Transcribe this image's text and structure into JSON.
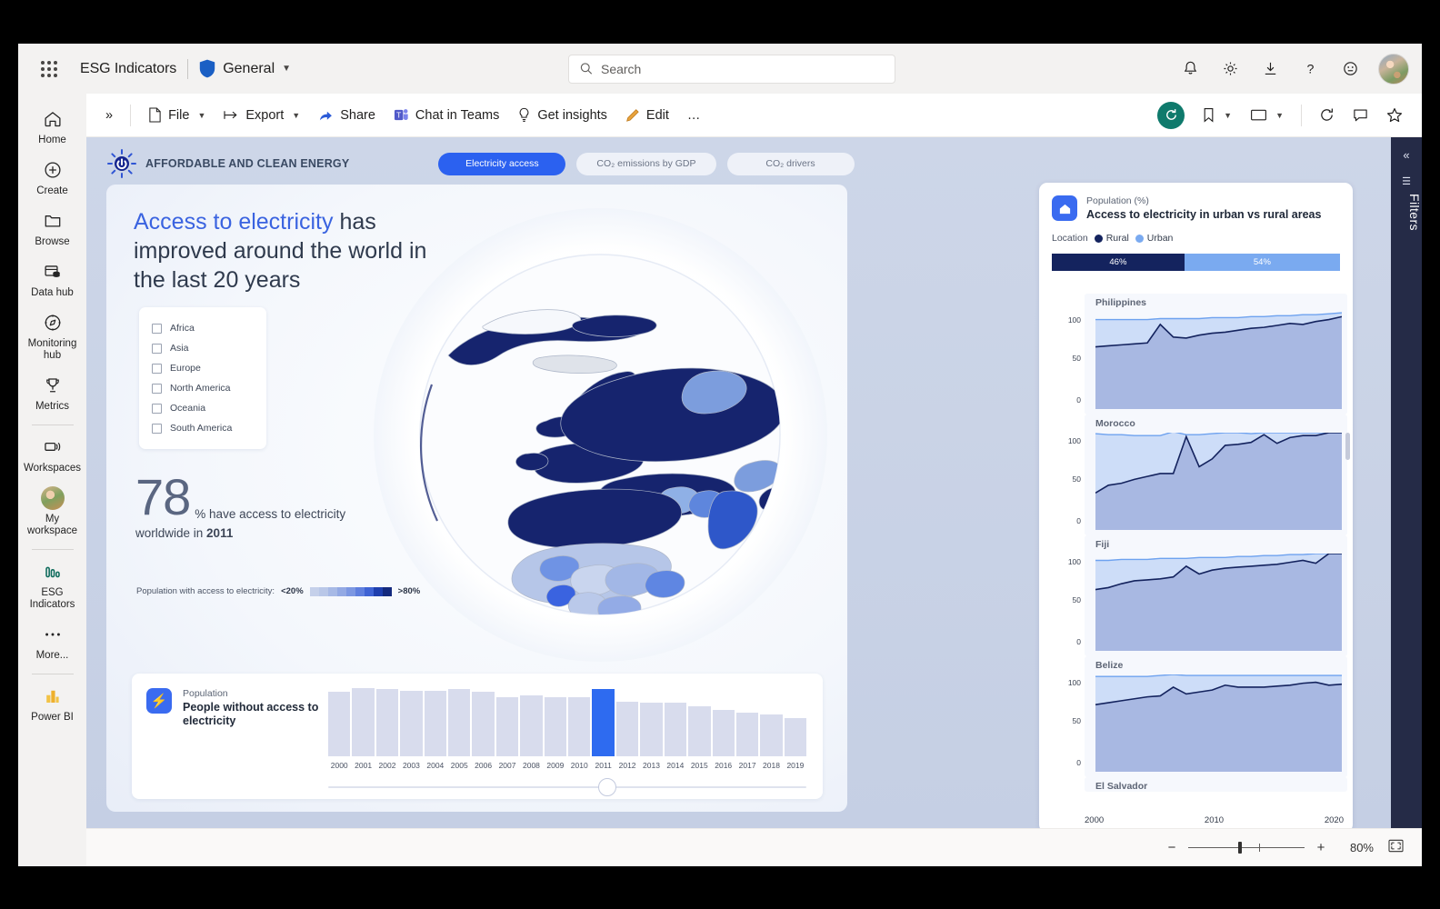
{
  "header": {
    "brand": "ESG Indicators",
    "workspace": "General",
    "search_placeholder": "Search",
    "icons": [
      "notifications-bell-icon",
      "settings-gear-icon",
      "download-icon",
      "help-icon",
      "feedback-smiley-icon"
    ]
  },
  "nav": {
    "items": [
      {
        "label": "Home",
        "icon": "home-icon"
      },
      {
        "label": "Create",
        "icon": "plus-circle-icon"
      },
      {
        "label": "Browse",
        "icon": "folder-icon"
      },
      {
        "label": "Data hub",
        "icon": "database-icon"
      },
      {
        "label": "Monitoring\nhub",
        "icon": "compass-icon"
      },
      {
        "label": "Metrics",
        "icon": "trophy-icon"
      },
      {
        "label": "Workspaces",
        "icon": "workspaces-icon"
      },
      {
        "label": "My\nworkspace",
        "icon": "avatar-icon"
      },
      {
        "label": "ESG\nIndicators",
        "icon": "bar-chart-icon"
      },
      {
        "label": "More...",
        "icon": "ellipsis-icon"
      },
      {
        "label": "Power BI",
        "icon": "power-bi-icon"
      }
    ]
  },
  "toolbar": {
    "expand": "»",
    "file": "File",
    "export": "Export",
    "share": "Share",
    "chat_in_teams": "Chat in Teams",
    "get_insights": "Get insights",
    "edit": "Edit",
    "more": "…",
    "reset": "reset-icon",
    "bookmarks": "bookmark-icon",
    "view": "view-icon",
    "refresh": "refresh-icon",
    "comment": "comment-icon",
    "favorite": "favorite-star-icon"
  },
  "report": {
    "sdg_label": "AFFORDABLE AND CLEAN ENERGY",
    "tabs": [
      {
        "label": "Electricity access",
        "active": true
      },
      {
        "label": "CO₂ emissions by GDP",
        "active": false
      },
      {
        "label": "CO₂ drivers",
        "active": false
      }
    ],
    "headline_highlight": "Access to electricity",
    "headline_rest": " has improved around the world in the last 20 years",
    "slicer": {
      "options": [
        "Africa",
        "Asia",
        "Europe",
        "North America",
        "Oceania",
        "South America"
      ]
    },
    "kpi": {
      "number": "78",
      "suffix": "% have access to electricity",
      "sub_prefix": "worldwide in ",
      "sub_year": "2011"
    },
    "map_legend": {
      "caption": "Population with access to electricity:",
      "low": "<20%",
      "high": ">80%",
      "swatches": [
        "#c5d0ea",
        "#b9c7e8",
        "#a7b9e6",
        "#93a9e4",
        "#7c97e2",
        "#5f7fde",
        "#3f63d4",
        "#1f3fae",
        "#142a7e"
      ]
    },
    "timeline": {
      "eyebrow": "Population",
      "title": "People without access to electricity",
      "selected_year": "2011",
      "years": [
        "2000",
        "2001",
        "2002",
        "2003",
        "2004",
        "2005",
        "2006",
        "2007",
        "2008",
        "2009",
        "2010",
        "2011",
        "2012",
        "2013",
        "2014",
        "2015",
        "2016",
        "2017",
        "2018",
        "2019"
      ],
      "values": [
        80,
        85,
        84,
        82,
        82,
        84,
        80,
        74,
        76,
        74,
        74,
        84,
        68,
        67,
        67,
        62,
        58,
        54,
        52,
        48
      ]
    }
  },
  "panel": {
    "eyebrow": "Population (%)",
    "title": "Access to electricity in urban vs rural areas",
    "legend_label": "Location",
    "legend": [
      {
        "name": "Rural",
        "color": "#14235e"
      },
      {
        "name": "Urban",
        "color": "#7aaaf0"
      }
    ],
    "split": [
      {
        "label": "46%",
        "value": 46,
        "color": "#14235e"
      },
      {
        "label": "54%",
        "value": 54,
        "color": "#7aaaf0"
      }
    ],
    "y_ticks": [
      "100",
      "50",
      "0"
    ],
    "x_ticks": [
      "2000",
      "2010",
      "2020"
    ],
    "partial_next": "El Salvador"
  },
  "filters": {
    "label": "Filters",
    "collapse": "«",
    "icon": "filter-icon"
  },
  "status": {
    "zoom_out": "−",
    "zoom_in": "+",
    "zoom_level": "80%",
    "fit": "fit-to-page-icon"
  },
  "chart_data": [
    {
      "type": "bar",
      "title": "People without access to electricity",
      "categories": [
        "2000",
        "2001",
        "2002",
        "2003",
        "2004",
        "2005",
        "2006",
        "2007",
        "2008",
        "2009",
        "2010",
        "2011",
        "2012",
        "2013",
        "2014",
        "2015",
        "2016",
        "2017",
        "2018",
        "2019"
      ],
      "values": [
        80,
        85,
        84,
        82,
        82,
        84,
        80,
        74,
        76,
        74,
        74,
        84,
        68,
        67,
        67,
        62,
        58,
        54,
        52,
        48
      ],
      "highlight_category": "2011",
      "xlabel": "",
      "ylabel": "Population",
      "grid": false,
      "legend": "none"
    },
    {
      "type": "bar",
      "title": "Access to electricity in urban vs rural areas",
      "categories": [
        "Rural",
        "Urban"
      ],
      "values": [
        46,
        54
      ],
      "ylabel": "Population (%)",
      "legend": "top",
      "stacked": true
    },
    {
      "type": "area",
      "title": "Philippines",
      "x": [
        2000,
        2001,
        2002,
        2003,
        2004,
        2005,
        2006,
        2007,
        2008,
        2009,
        2010,
        2011,
        2012,
        2013,
        2014,
        2015,
        2016,
        2017,
        2018,
        2019
      ],
      "series": [
        {
          "name": "Urban",
          "values": [
            92,
            92,
            92,
            92,
            92,
            93,
            93,
            93,
            93,
            94,
            94,
            94,
            95,
            95,
            96,
            96,
            97,
            97,
            98,
            99
          ]
        },
        {
          "name": "Rural",
          "values": [
            64,
            65,
            66,
            67,
            68,
            87,
            74,
            73,
            76,
            78,
            79,
            81,
            83,
            84,
            86,
            88,
            87,
            90,
            92,
            95
          ]
        }
      ],
      "ylim": [
        0,
        100
      ],
      "y_ticks": [
        0,
        50,
        100
      ],
      "xlim": [
        2000,
        2020
      ]
    },
    {
      "type": "area",
      "title": "Morocco",
      "x": [
        2000,
        2001,
        2002,
        2003,
        2004,
        2005,
        2006,
        2007,
        2008,
        2009,
        2010,
        2011,
        2012,
        2013,
        2014,
        2015,
        2016,
        2017,
        2018,
        2019
      ],
      "series": [
        {
          "name": "Urban",
          "values": [
            99,
            98,
            98,
            97,
            97,
            97,
            101,
            98,
            98,
            99,
            100,
            100,
            99,
            100,
            100,
            100,
            100,
            100,
            100,
            100
          ]
        },
        {
          "name": "Rural",
          "values": [
            38,
            46,
            48,
            52,
            55,
            58,
            58,
            96,
            65,
            73,
            87,
            88,
            90,
            98,
            89,
            95,
            97,
            97,
            100,
            100
          ]
        }
      ],
      "ylim": [
        0,
        100
      ],
      "y_ticks": [
        0,
        50,
        100
      ],
      "xlim": [
        2000,
        2020
      ]
    },
    {
      "type": "area",
      "title": "Fiji",
      "x": [
        2000,
        2001,
        2002,
        2003,
        2004,
        2005,
        2006,
        2007,
        2008,
        2009,
        2010,
        2011,
        2012,
        2013,
        2014,
        2015,
        2016,
        2017,
        2018,
        2019
      ],
      "series": [
        {
          "name": "Urban",
          "values": [
            93,
            93,
            94,
            94,
            94,
            95,
            95,
            95,
            96,
            96,
            96,
            97,
            97,
            98,
            98,
            99,
            99,
            100,
            100,
            100
          ]
        },
        {
          "name": "Rural",
          "values": [
            63,
            65,
            69,
            72,
            73,
            74,
            76,
            87,
            79,
            83,
            85,
            86,
            87,
            88,
            89,
            91,
            93,
            90,
            100,
            100
          ]
        }
      ],
      "ylim": [
        0,
        100
      ],
      "y_ticks": [
        0,
        50,
        100
      ],
      "xlim": [
        2000,
        2020
      ]
    },
    {
      "type": "area",
      "title": "Belize",
      "x": [
        2000,
        2001,
        2002,
        2003,
        2004,
        2005,
        2006,
        2007,
        2008,
        2009,
        2010,
        2011,
        2012,
        2013,
        2014,
        2015,
        2016,
        2017,
        2018,
        2019
      ],
      "series": [
        {
          "name": "Urban",
          "values": [
            98,
            98,
            98,
            98,
            98,
            99,
            100,
            99,
            99,
            99,
            99,
            99,
            99,
            99,
            99,
            99,
            99,
            99,
            99,
            99
          ]
        },
        {
          "name": "Rural",
          "values": [
            69,
            71,
            73,
            75,
            77,
            78,
            87,
            80,
            82,
            84,
            89,
            87,
            87,
            87,
            88,
            89,
            91,
            92,
            89,
            90
          ]
        }
      ],
      "ylim": [
        0,
        100
      ],
      "y_ticks": [
        0,
        50,
        100
      ],
      "xlim": [
        2000,
        2020
      ]
    }
  ]
}
